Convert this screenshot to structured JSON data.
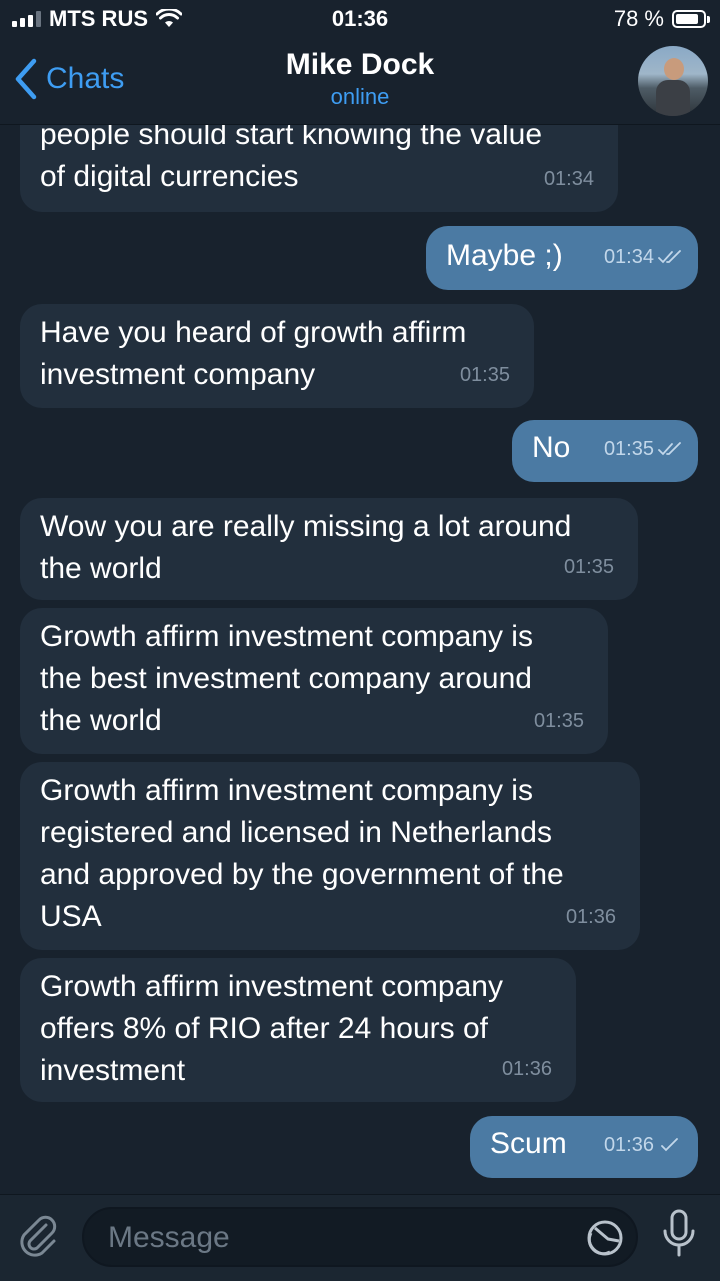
{
  "status_bar": {
    "carrier": "MTS RUS",
    "time": "01:36",
    "battery": "78 %"
  },
  "header": {
    "back_label": "Chats",
    "contact_name": "Mike Dock",
    "contact_status": "online"
  },
  "messages": [
    {
      "text": "people should start knowing the value\nof digital currencies",
      "time": "01:34"
    },
    {
      "text": "Maybe ;)",
      "time": "01:34"
    },
    {
      "text": "Have you heard of growth affirm\ninvestment company",
      "time": "01:35"
    },
    {
      "text": "No",
      "time": "01:35"
    },
    {
      "text": "Wow you are really missing a lot around\nthe world",
      "time": "01:35"
    },
    {
      "text": "Growth affirm investment company is\nthe best investment company around\nthe world",
      "time": "01:35"
    },
    {
      "text": "Growth affirm investment company is\nregistered and licensed in Netherlands\nand approved by the government of the\nUSA",
      "time": "01:36"
    },
    {
      "text": "Growth affirm investment company\noffers 8% of RIO after 24 hours of\ninvestment",
      "time": "01:36"
    },
    {
      "text": "Scum",
      "time": "01:36"
    }
  ],
  "composer": {
    "placeholder": "Message"
  },
  "colors": {
    "background": "#18222d",
    "incoming_bubble": "#222f3d",
    "outgoing_bubble": "#4b7aa3",
    "accent": "#3e9df2"
  },
  "icons": {
    "attach": "paperclip-icon",
    "sticker": "sticker-icon",
    "mic": "microphone-icon",
    "back": "chevron-left-icon"
  }
}
